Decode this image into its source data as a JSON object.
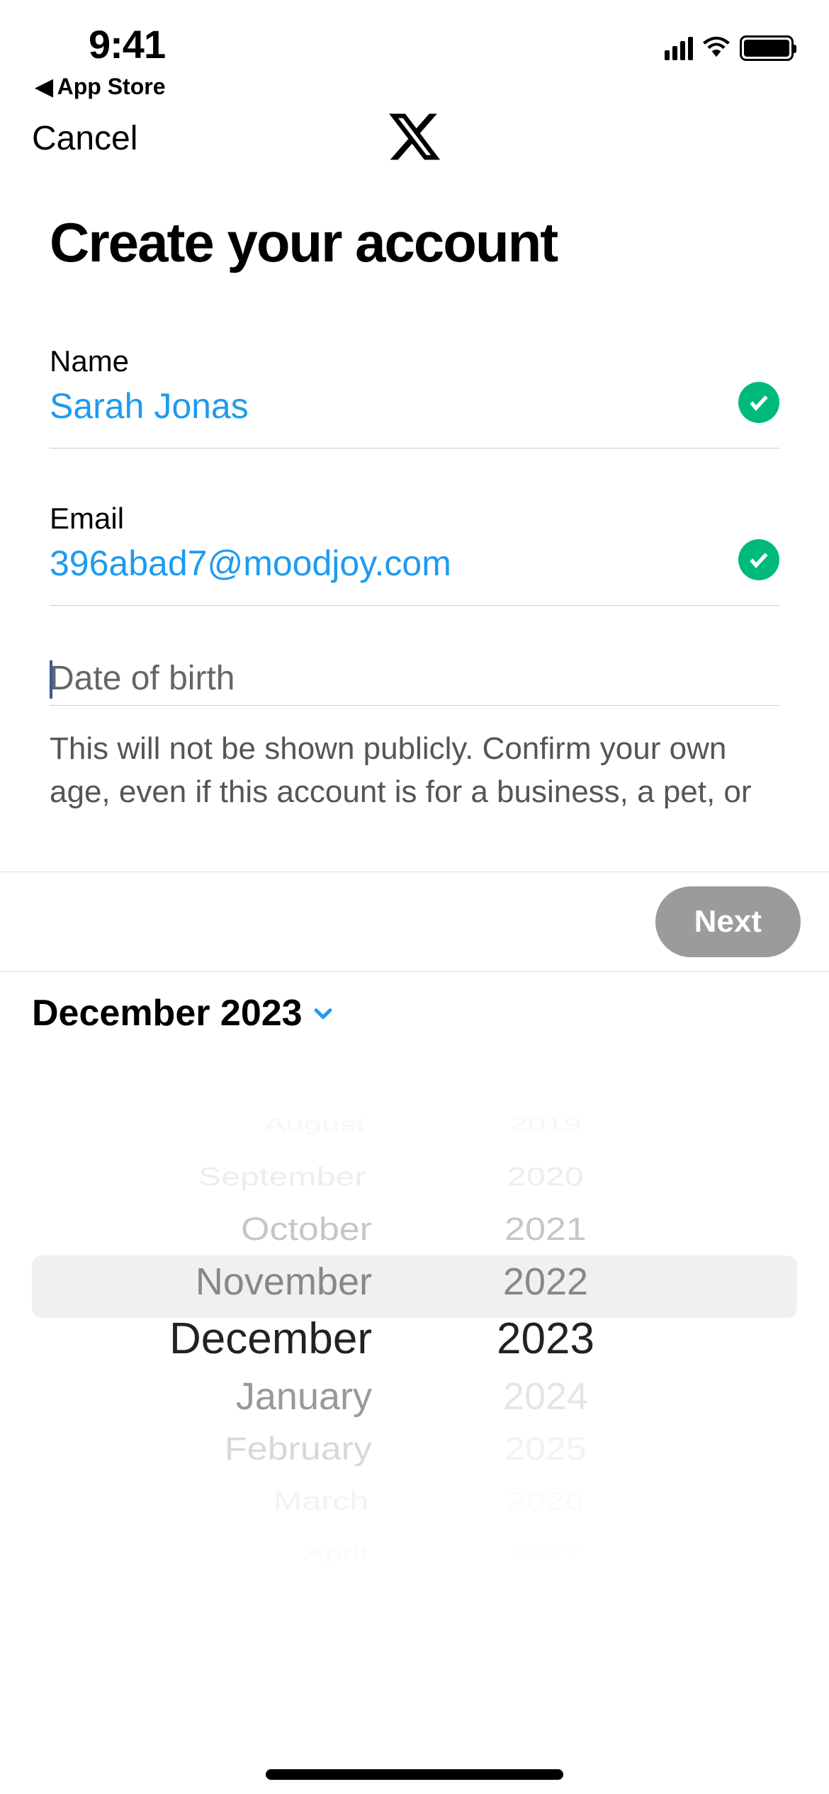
{
  "status_bar": {
    "time": "9:41",
    "back_label": "App Store"
  },
  "header": {
    "cancel": "Cancel"
  },
  "title": "Create your account",
  "fields": {
    "name": {
      "label": "Name",
      "value": "Sarah Jonas",
      "valid": true
    },
    "email": {
      "label": "Email",
      "value": "396abad7@moodjoy.com",
      "valid": true
    },
    "dob": {
      "placeholder": "Date of birth"
    }
  },
  "helper": "This will not be shown publicly. Confirm your own age, even if this account is for a business, a pet, or",
  "next_label": "Next",
  "picker": {
    "header": "December 2023",
    "months": [
      "August",
      "September",
      "October",
      "November",
      "December",
      "January",
      "February",
      "March",
      "April"
    ],
    "years": [
      "2019",
      "2020",
      "2021",
      "2022",
      "2023",
      "2024",
      "2025",
      "2026",
      "2027"
    ],
    "selected_month": "December",
    "selected_year": "2023"
  }
}
